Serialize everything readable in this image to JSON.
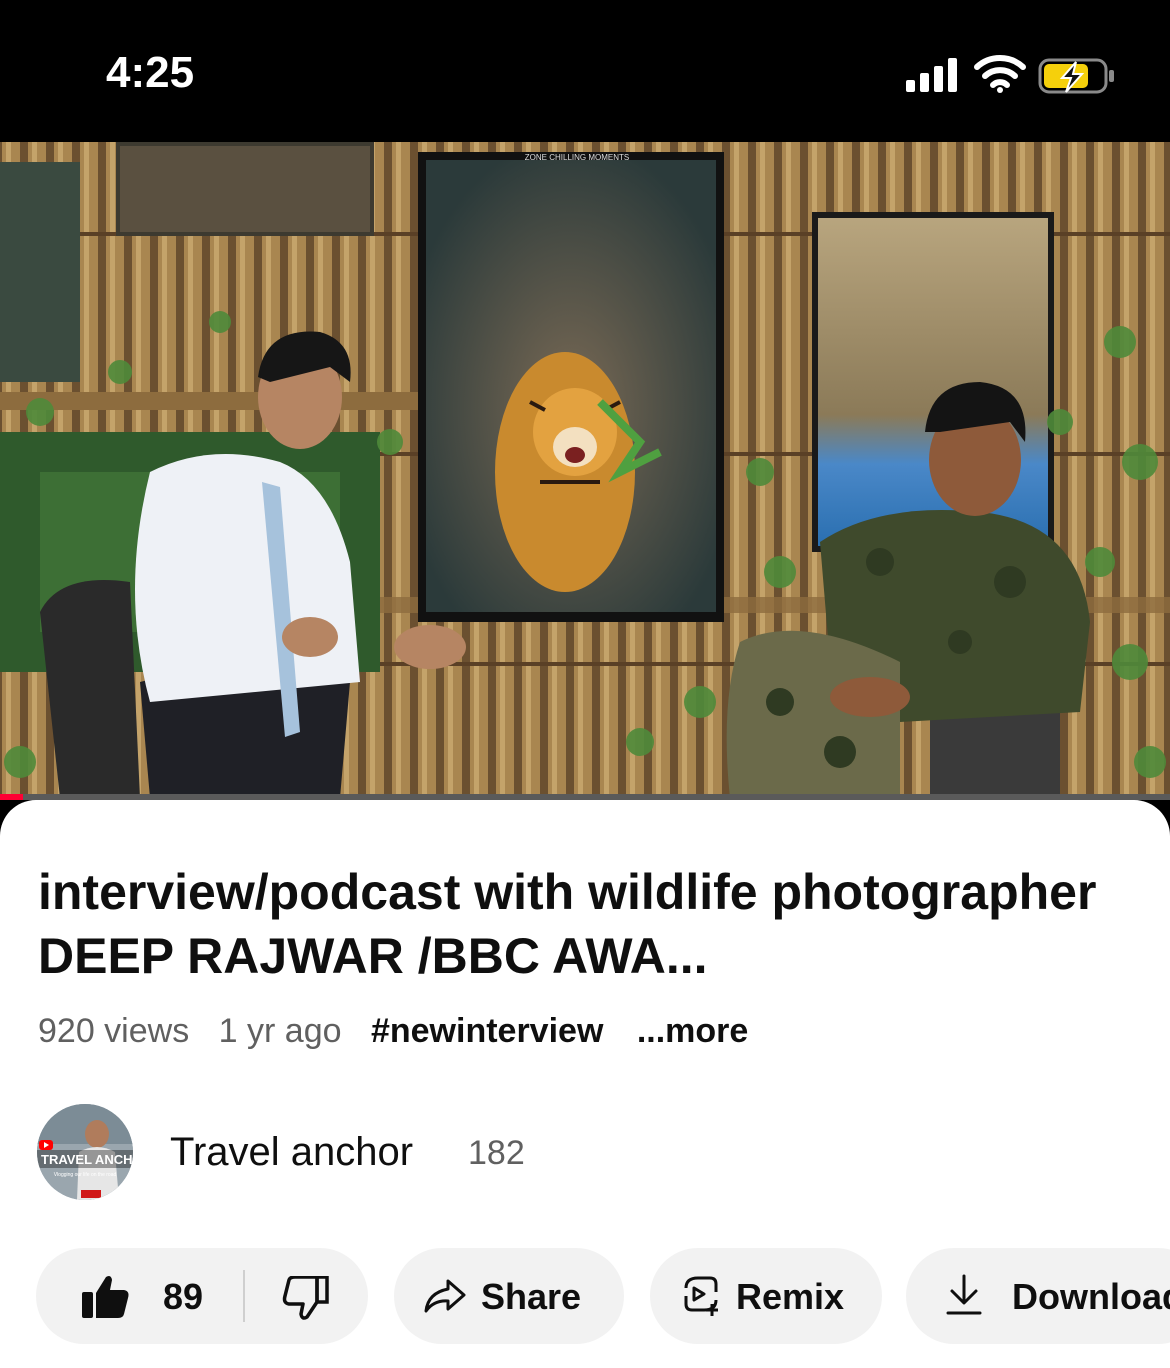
{
  "status_bar": {
    "time": "4:25"
  },
  "player": {
    "progress_fraction": 0.02,
    "progress_color": "#ff0033",
    "poster_text": "ZONE CHILLING MOMENTS"
  },
  "video": {
    "title": "interview/podcast with wildlife photographer DEEP RAJWAR /BBC AWA...",
    "views": "920 views",
    "age": "1 yr ago",
    "hashtag": "#newinterview",
    "more": "...more"
  },
  "channel": {
    "name": "Travel anchor",
    "subscribers": "182",
    "avatar_text": "TRAVEL ANCH",
    "avatar_subtext": "Vlogging our life on the road"
  },
  "actions": {
    "like_count": "89",
    "share_label": "Share",
    "remix_label": "Remix",
    "download_label": "Download"
  }
}
